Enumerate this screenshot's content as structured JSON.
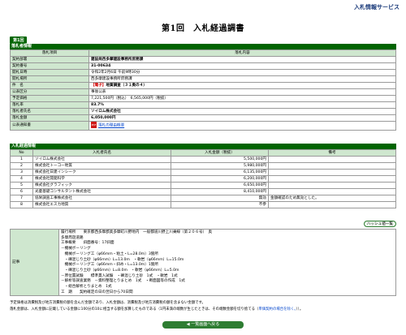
{
  "header": {
    "service": "入札情報サービス",
    "title": "第1回　入札経過調書",
    "round": "第1回"
  },
  "info": {
    "section": "落札者情報",
    "col_item": "落札項目",
    "col_content": "落札内容",
    "rows": [
      {
        "label": "契約部署",
        "value": "建設局西多摩建設事務所庶務課",
        "bold": true
      },
      {
        "label": "契約番号",
        "value": "31-00634",
        "bold": true
      },
      {
        "label": "開札日時",
        "value": "令和2年2月6日 午前9時30分"
      },
      {
        "label": "開札場所",
        "value": "西多摩建設事務所庶務課"
      },
      {
        "label": "件　名",
        "tag": "【電子】",
        "value": "地質調査（３１奥の４）",
        "bold": true
      },
      {
        "label": "公表区分",
        "value": "事後公表"
      },
      {
        "label": "予定価格",
        "value": "7,221,500円（税込）　6,565,000円（税抜）"
      },
      {
        "label": "落札率",
        "value": "83.7%",
        "bold": true
      },
      {
        "label": "落札者氏名",
        "value": "ソイロム株式会社",
        "bold": true
      },
      {
        "label": "落札金額",
        "value": "6,050,000円",
        "bold": true
      },
      {
        "label": "公表通知書",
        "value": "落札の理由概要",
        "pdf": "PDF"
      }
    ]
  },
  "bids": {
    "section": "入札経過情報",
    "headers": [
      "No",
      "入札者氏名",
      "入札金額（税抜）",
      "備考"
    ],
    "rows": [
      {
        "no": "1",
        "name": "ソイロム株式会社",
        "amount": "5,500,000円",
        "note": ""
      },
      {
        "no": "2",
        "name": "株式会社トーコー地質",
        "amount": "5,980,000円",
        "note": ""
      },
      {
        "no": "3",
        "name": "株式会社日建インシーク",
        "amount": "6,135,000円",
        "note": ""
      },
      {
        "no": "4",
        "name": "株式会社開発科学",
        "amount": "6,200,000円",
        "note": ""
      },
      {
        "no": "5",
        "name": "株式会社グラフィック",
        "amount": "6,650,000円",
        "note": ""
      },
      {
        "no": "6",
        "name": "光菱基礎コンサルタント株式会社",
        "amount": "8,410,000円",
        "note": ""
      },
      {
        "no": "7",
        "name": "協栄調査工事株式会社",
        "amount": "無効",
        "note": "金額確認のため無効とした。"
      },
      {
        "no": "8",
        "name": "株式会社エスカ地質",
        "amount": "不参",
        "note": ""
      }
    ],
    "hash_button": "ハッシュ値一覧"
  },
  "remarks": {
    "label": "記事",
    "lines": [
      "履行場所　　東京都西多摩郡奥多摩町川野地内　一般都道川野上川乗線（第２０６号）　奥",
      "多摩周遊道路",
      "工事概要　　斜面番号：17斜面",
      "－機械ボーリング",
      "　機械ボーリング工（φ66mm・粘土・L=28.0m）3箇所",
      "　・礫混じり土砂（φ66mm）L=13.0m　・軟岩（φ66mm）L=15.0m",
      "　機械ボーリング工（φ66mm・斜め・L=13.0m）1箇所",
      "　・礫混じり土砂（φ66mm）L=8.0m　・軟岩（φ66mm）L=5.0m",
      "－原位置試験　　標準貫入試験　・礫混じり土砂　1式　・軟岩　1式",
      "－解析等調査業務　－資料整理とりまとめ　1式　・断面図等の作成　1式",
      "　・総合解析とりまとめ　1式",
      "工　期　　契約確定の日の翌日から70日間"
    ]
  },
  "notes": {
    "line1": "予定価格は消費税及び地方消費税の額を含んだ金額であり、入札金額は、消費税及び地方消費税の額を含まない金額です。",
    "line2_pre": "落札金額は、入札金額に記載している金額に100分の10に相当する額を加算したものである（1円未満の端数が生じたときは、その端数金額を切り捨てる（",
    "line2_link": "単価契約の場合を除く。",
    "line2_post": "））。"
  },
  "back_button": "◀ 一覧画面へ戻る",
  "colors": {
    "accent": "#006400",
    "label_bg": "#cfe7cf",
    "tag_red": "#d00000"
  }
}
